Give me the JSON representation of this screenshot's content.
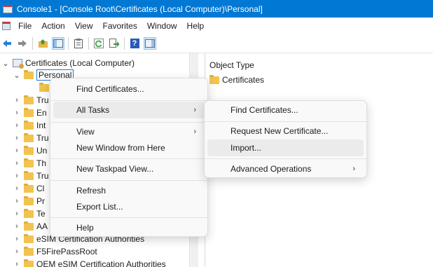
{
  "window": {
    "title": "Console1 - [Console Root\\Certificates (Local Computer)\\Personal]"
  },
  "menubar": {
    "items": [
      "File",
      "Action",
      "View",
      "Favorites",
      "Window",
      "Help"
    ]
  },
  "toolbar": {
    "icons": [
      "back-arrow-icon",
      "forward-arrow-icon",
      "up-folder-icon",
      "show-hide-tree-icon",
      "properties-icon",
      "refresh-icon",
      "export-list-icon",
      "help-icon",
      "show-action-pane-icon"
    ],
    "help_label": "?"
  },
  "tree": {
    "root": {
      "label": "Certificates (Local Computer)",
      "expanded": true
    },
    "selected": {
      "label": "Personal",
      "expanded": true
    },
    "child_visible_fragment": "",
    "partial_items": [
      "Tru",
      "En",
      "Int",
      "Tru",
      "Un",
      "Th",
      "Tru",
      "Cl",
      "Pr",
      "Te",
      "AA"
    ],
    "full_items": [
      "eSIM Certification Authorities",
      "F5FirePassRoot",
      "OEM eSIM Certification Authorities"
    ]
  },
  "right_pane": {
    "column_header": "Object Type",
    "rows": [
      {
        "label": "Certificates"
      }
    ]
  },
  "context_menu": {
    "find_certificates": "Find Certificates...",
    "all_tasks": "All Tasks",
    "view": "View",
    "new_window": "New Window from Here",
    "new_taskpad": "New Taskpad View...",
    "refresh": "Refresh",
    "export_list": "Export List...",
    "help": "Help"
  },
  "submenu": {
    "find_certificates": "Find Certificates...",
    "request_new": "Request New Certificate...",
    "import": "Import...",
    "advanced": "Advanced Operations"
  },
  "glyphs": {
    "chevron_right": "›",
    "chevron_down": "⌄"
  },
  "colors": {
    "titlebar": "#0078d4",
    "selection_border": "#1e79d6",
    "folder": "#f2c350",
    "menu_hover": "#ebebeb"
  }
}
